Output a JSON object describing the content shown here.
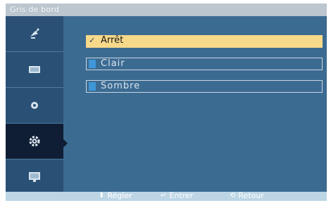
{
  "title": "Gris de bord",
  "sidebar": {
    "items": [
      {
        "icon": "satellite-dish-icon",
        "active": false
      },
      {
        "icon": "tv-screen-icon",
        "active": false
      },
      {
        "icon": "speaker-sound-icon",
        "active": false
      },
      {
        "icon": "gear-settings-icon",
        "active": true
      },
      {
        "icon": "monitor-info-icon",
        "active": false
      }
    ]
  },
  "options": [
    {
      "label": "Arrêt",
      "selected": true,
      "check": "✓"
    },
    {
      "label": "Clair",
      "selected": false
    },
    {
      "label": "Sombre",
      "selected": false
    }
  ],
  "footer": {
    "adjust": {
      "icon": "up-down-arrows-icon",
      "glyph": "⬍",
      "label": "Régler"
    },
    "enter": {
      "icon": "enter-icon",
      "glyph": "↵",
      "label": "Entrer"
    },
    "return": {
      "icon": "return-icon",
      "glyph": "⟲",
      "label": "Retour"
    }
  },
  "colors": {
    "panel": "#3c6b92",
    "sidebar": "#2a5175",
    "active_item": "#0f1e34",
    "highlight": "#f7d98a",
    "swatch": "#3f97d8"
  }
}
